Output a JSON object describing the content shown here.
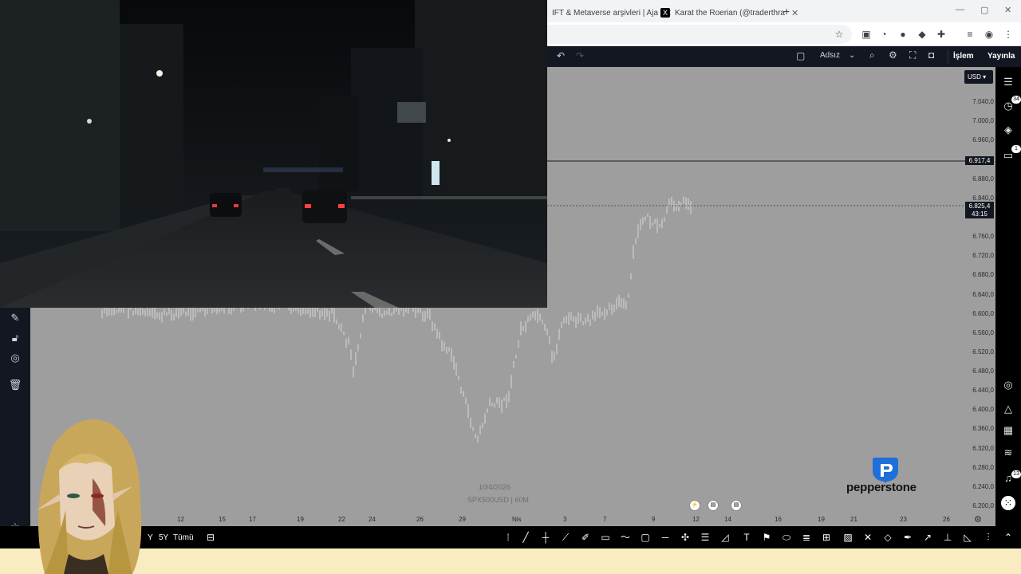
{
  "browser": {
    "tabs": [
      {
        "label": "IFT & Metaverse arşivleri | Aja",
        "close": "✕"
      },
      {
        "label": "Karat the Roerian (@traderthra",
        "close": "✕",
        "icon": "X"
      }
    ],
    "new_tab": "+",
    "window_controls": {
      "minimize": "—",
      "maximize": "▢",
      "close": "✕"
    }
  },
  "tv_header": {
    "layout_name": "Adsız",
    "trade_button": "İşlem",
    "publish_button": "Yayınla"
  },
  "price_axis": {
    "currency": "USD",
    "labels": [
      "7.040,0",
      "7.000,0",
      "6.960,0",
      "6.880,0",
      "6.840,0",
      "6.760,0",
      "6.720,0",
      "6.680,0",
      "6.640,0",
      "6.600,0",
      "6.560,0",
      "6.520,0",
      "6.480,0",
      "6.440,0",
      "6.400,0",
      "6.360,0",
      "6.320,0",
      "6.280,0",
      "6.240,0",
      "6.200,0"
    ],
    "line_tag": "6.917,4",
    "last_price_tag": "6.825,4",
    "countdown_tag": "43:15"
  },
  "time_axis": {
    "labels": [
      "12",
      "15",
      "17",
      "19",
      "22",
      "24",
      "26",
      "29",
      "Nis",
      "3",
      "7",
      "9",
      "12",
      "14",
      "16",
      "19",
      "21",
      "23",
      "26"
    ]
  },
  "watermark": {
    "date": "10/4/2026",
    "symbol": "SPX500USD",
    "interval": "60M"
  },
  "bottom_bar": {
    "ranges": [
      "Y",
      "5Y",
      "Tümü"
    ]
  },
  "right_bar": {
    "badges": {
      "alerts": "34",
      "ideas": "1",
      "notifications": "13"
    }
  },
  "broker": {
    "name": "pepperstone"
  },
  "colors": {
    "chart_bg": "#9e9e9e",
    "header_bg": "#131722",
    "bottom_strip": "#f9ecc0",
    "candle": "#d8d8d8"
  }
}
